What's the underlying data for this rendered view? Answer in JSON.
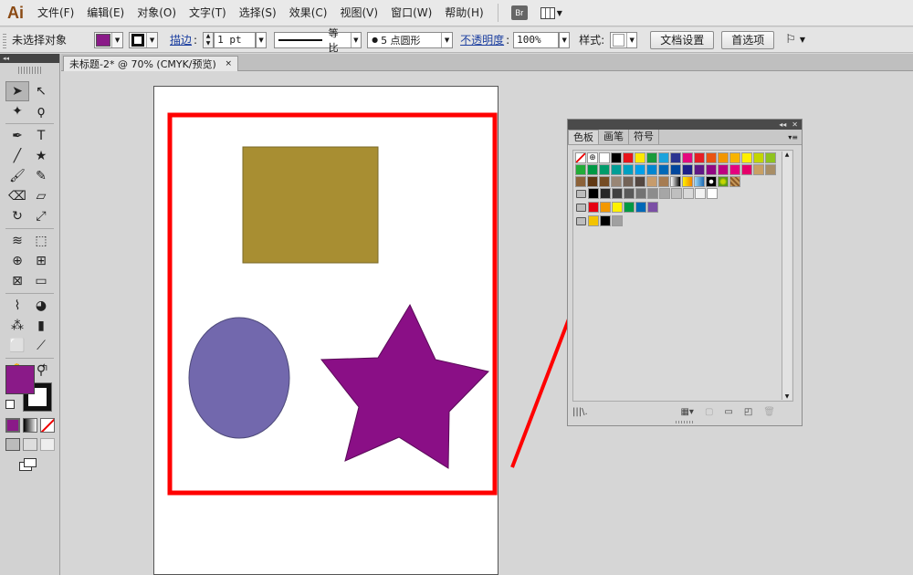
{
  "app": {
    "logo": "Ai"
  },
  "menu": [
    "文件(F)",
    "编辑(E)",
    "对象(O)",
    "文字(T)",
    "选择(S)",
    "效果(C)",
    "视图(V)",
    "窗口(W)",
    "帮助(H)"
  ],
  "menu_extra": {
    "bridge": "Br"
  },
  "control": {
    "selection_status": "未选择对象",
    "stroke_link": "描边",
    "stroke_weight": "1 pt",
    "profile_label": "等比",
    "brush_label": "5 点圆形",
    "brush_dot": "●",
    "opacity_link": "不透明度",
    "opacity_value": "100%",
    "style_label": "样式:",
    "doc_setup": "文档设置",
    "preferences": "首选项"
  },
  "colors": {
    "fill": "#8a1a88",
    "brown": "#a88e32",
    "ellipse": "#7268ad",
    "star": "#8a0f86",
    "annotation": "#ff0000"
  },
  "document": {
    "tab_title": "未标题-2* @ 70% (CMYK/预览)",
    "close": "×"
  },
  "tools": [
    [
      "selection-tool",
      "direct-selection-tool"
    ],
    [
      "magic-wand-tool",
      "lasso-tool"
    ],
    [
      "pen-tool",
      "type-tool"
    ],
    [
      "line-tool",
      "star-tool"
    ],
    [
      "paintbrush-tool",
      "pencil-tool"
    ],
    [
      "blob-brush-tool",
      "eraser-tool"
    ],
    [
      "rotate-tool",
      "scale-tool"
    ],
    [
      "width-tool",
      "free-transform-tool"
    ],
    [
      "shape-builder-tool",
      "perspective-grid-tool"
    ],
    [
      "mesh-tool",
      "gradient-tool"
    ],
    [
      "eyedropper-tool",
      "blend-tool"
    ],
    [
      "symbol-sprayer-tool",
      "column-graph-tool"
    ],
    [
      "artboard-tool",
      "slice-tool"
    ],
    [
      "hand-tool",
      "zoom-tool"
    ]
  ],
  "tool_glyphs": {
    "selection-tool": "➤",
    "direct-selection-tool": "↖",
    "magic-wand-tool": "✦",
    "lasso-tool": "ϙ",
    "pen-tool": "✒",
    "type-tool": "T",
    "line-tool": "╱",
    "star-tool": "★",
    "paintbrush-tool": "🖌",
    "pencil-tool": "✎",
    "blob-brush-tool": "⌫",
    "eraser-tool": "▱",
    "rotate-tool": "↻",
    "scale-tool": "⤢",
    "width-tool": "≋",
    "free-transform-tool": "⬚",
    "shape-builder-tool": "⊕",
    "perspective-grid-tool": "⊞",
    "mesh-tool": "⊠",
    "gradient-tool": "▭",
    "eyedropper-tool": "⌇",
    "blend-tool": "◕",
    "symbol-sprayer-tool": "⁂",
    "column-graph-tool": "▮",
    "artboard-tool": "⬜",
    "slice-tool": "⟋",
    "hand-tool": "✋",
    "zoom-tool": "⚲"
  },
  "panel": {
    "tabs": [
      "色板",
      "画笔",
      "符号"
    ],
    "footer_left": "|||\\.",
    "swatch_rows": [
      [
        "none",
        "registration",
        "#ffffff",
        "#000000",
        "#e8141b",
        "#fde802",
        "#1a9b3c",
        "#1ba3dc",
        "#2c3590",
        "#e4097e",
        "#e61e25",
        "#ea5412",
        "#f29600",
        "#f8b400",
        "#fff000",
        "#c3d600",
        "#8fc31f"
      ],
      [
        "#22ac38",
        "#009944",
        "#009b6b",
        "#009e96",
        "#00a0c1",
        "#00a0e9",
        "#0086d1",
        "#0068b7",
        "#00479d",
        "#1d2088",
        "#601986",
        "#920783",
        "#be0081",
        "#e4007f",
        "#e5006a",
        "#c9a063",
        "#a88e66"
      ],
      [
        "#8c6239",
        "#603813",
        "#754c24",
        "#998675",
        "#736357",
        "#534741",
        "#c69c6d",
        "#a67c52",
        "gradient-bw",
        "gradient-orange",
        "gradient-blue",
        "pattern-dot",
        "pattern-leaf",
        "pattern-stripe"
      ],
      [
        "folder",
        "#000000",
        "#262626",
        "#404040",
        "#595959",
        "#737373",
        "#8c8c8c",
        "#a6a6a6",
        "#bfbfbf",
        "#d9d9d9",
        "#f2f2f2",
        "#ffffff"
      ],
      [
        "folder",
        "#e60012",
        "#f39800",
        "#fff100",
        "#009944",
        "#0068b7",
        "#7b4fa5"
      ],
      [
        "folder",
        "#f2c300",
        "#000000",
        "#a0a0a0"
      ]
    ]
  }
}
